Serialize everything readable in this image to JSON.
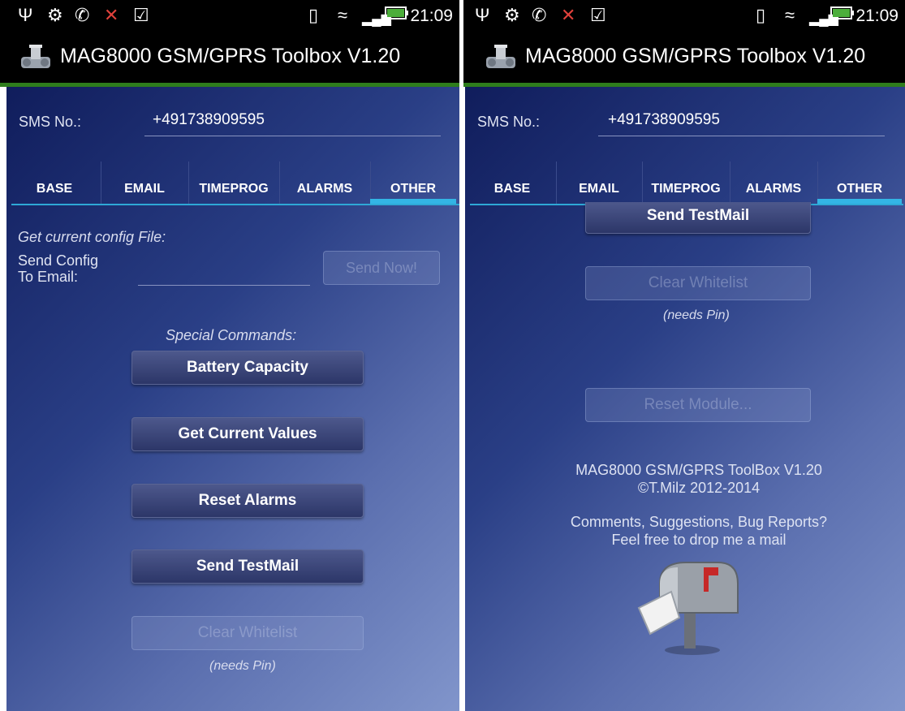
{
  "status_bar": {
    "time": "21:09"
  },
  "app": {
    "title": "MAG8000 GSM/GPRS Toolbox V1.20"
  },
  "sms": {
    "label": "SMS No.:",
    "value": "+491738909595"
  },
  "tabs": [
    {
      "label": "BASE"
    },
    {
      "label": "EMAIL"
    },
    {
      "label": "TIMEPROG"
    },
    {
      "label": "ALARMS"
    },
    {
      "label": "OTHER",
      "selected": true
    }
  ],
  "config": {
    "header": "Get current config File:",
    "send_label_line1": "Send Config",
    "send_label_line2": "To Email:",
    "email_value": "",
    "send_button": "Send Now!"
  },
  "special": {
    "header": "Special Commands:",
    "buttons": {
      "battery": "Battery Capacity",
      "current_values": "Get Current Values",
      "reset_alarms": "Reset Alarms",
      "send_testmail": "Send TestMail",
      "clear_whitelist": "Clear Whitelist",
      "reset_module": "Reset Module..."
    },
    "needs_pin": "(needs Pin)"
  },
  "about": {
    "line1": "MAG8000 GSM/GPRS ToolBox V1.20",
    "line2": "©T.Milz 2012-2014",
    "line3": "Comments, Suggestions, Bug Reports?",
    "line4": "Feel free to drop me a mail"
  },
  "icons": {
    "status_left": [
      "usb-icon",
      "android-debug-icon",
      "whatsapp-icon",
      "missed-call-icon",
      "task-check-icon"
    ],
    "status_right": [
      "vibrate-icon",
      "wifi-icon",
      "signal-icon",
      "battery-charging-icon"
    ],
    "app": "flowmeter-icon",
    "mail": "mailbox-icon"
  },
  "colors": {
    "accent": "#33b5e5",
    "title_underline": "#2e7d1c"
  }
}
